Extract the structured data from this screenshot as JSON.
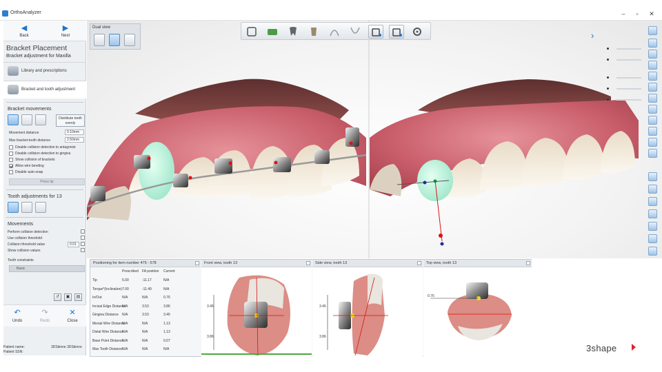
{
  "app": {
    "title": "OrthoAnalyzer",
    "window_buttons": [
      "–",
      "▫",
      "✕"
    ]
  },
  "nav": {
    "back_label": "Back",
    "next_label": "Next"
  },
  "step": {
    "title": "Bracket Placement",
    "subtitle": "Bracket adjustment for Maxilla"
  },
  "stages": [
    {
      "label": "Library and prescriptions"
    },
    {
      "label": "Bracket and tooth adjustment"
    }
  ],
  "bracket_movements": {
    "heading": "Bracket movements",
    "distribute_label": "Distribute teeth evenly",
    "fields": [
      {
        "label": "Movement distance",
        "value": "0.10mm"
      },
      {
        "label": "Max bracket-tooth distance",
        "value": "2.50mm"
      }
    ],
    "options": [
      {
        "label": "Disable collision detection to antagonist",
        "checked": false
      },
      {
        "label": "Disable collision detection to gingiva",
        "checked": false
      },
      {
        "label": "Show collision of brackets",
        "checked": false
      },
      {
        "label": "Allow wire bending",
        "checked": true
      },
      {
        "label": "Disable auto-snap",
        "checked": false
      }
    ],
    "press_label": "Press tip"
  },
  "tooth_adjustments": {
    "heading": "Tooth adjustments for 13"
  },
  "movements": {
    "heading": "Movements",
    "options": [
      {
        "label": "Perform collision detection",
        "checked": false
      },
      {
        "label": "Use collision threshold",
        "checked": false
      },
      {
        "label": "Collision threshold value",
        "value": "0.01"
      },
      {
        "label": "Show collision values",
        "checked": false
      }
    ],
    "constraints_label": "Tooth constraints",
    "constraints_value": "Basic"
  },
  "bottom_buttons": {
    "undo": "Undo",
    "redo": "Redo",
    "close": "Close"
  },
  "status": {
    "patient_name_label": "Patient name:",
    "patient_name_value": "3DSkinne 3DSkinne",
    "patient_ssn_label": "Patient SSN:"
  },
  "viewport": {
    "dual_view_label": "Dual view"
  },
  "positioning_panel": {
    "title": "Positioning for item number 475 - 578",
    "columns": [
      "",
      "Prescribed",
      "FA position",
      "Current"
    ],
    "rows": [
      [
        "Tip",
        "5.00",
        "-11.17",
        "N/A"
      ],
      [
        "Torque*(Inclination)",
        "7.00",
        "-11.49",
        "N/A"
      ],
      [
        "In/Out",
        "N/A",
        "N/A",
        "0.76"
      ],
      [
        "Incisal Edge Distance",
        "N/A",
        "3.53",
        "3.86"
      ],
      [
        "Gingiva Distance",
        "N/A",
        "3.53",
        "3.45"
      ],
      [
        "Mesial Wire Distance",
        "N/A",
        "N/A",
        "1.13"
      ],
      [
        "Distal Wire Distance",
        "N/A",
        "N/A",
        "1.13"
      ],
      [
        "Base Point Distance",
        "N/A",
        "N/A",
        "0.07"
      ],
      [
        "Max Tooth Distance",
        "N/A",
        "N/A",
        "N/A"
      ]
    ]
  },
  "front_view": {
    "title": "Front view, tooth 13",
    "dims": [
      "3.45",
      "3.86"
    ]
  },
  "side_view": {
    "title": "Side view, tooth 13",
    "dims": [
      "3.45",
      "3.86"
    ]
  },
  "top_view": {
    "title": "Top view, tooth 13",
    "dims": [
      "0.76"
    ]
  },
  "brand": {
    "logo": "3shape"
  },
  "colors": {
    "accent": "#2173c9",
    "brand_red": "#e0212f",
    "gingiva": "#d9737a",
    "selected_tooth": "#bff0dc"
  }
}
